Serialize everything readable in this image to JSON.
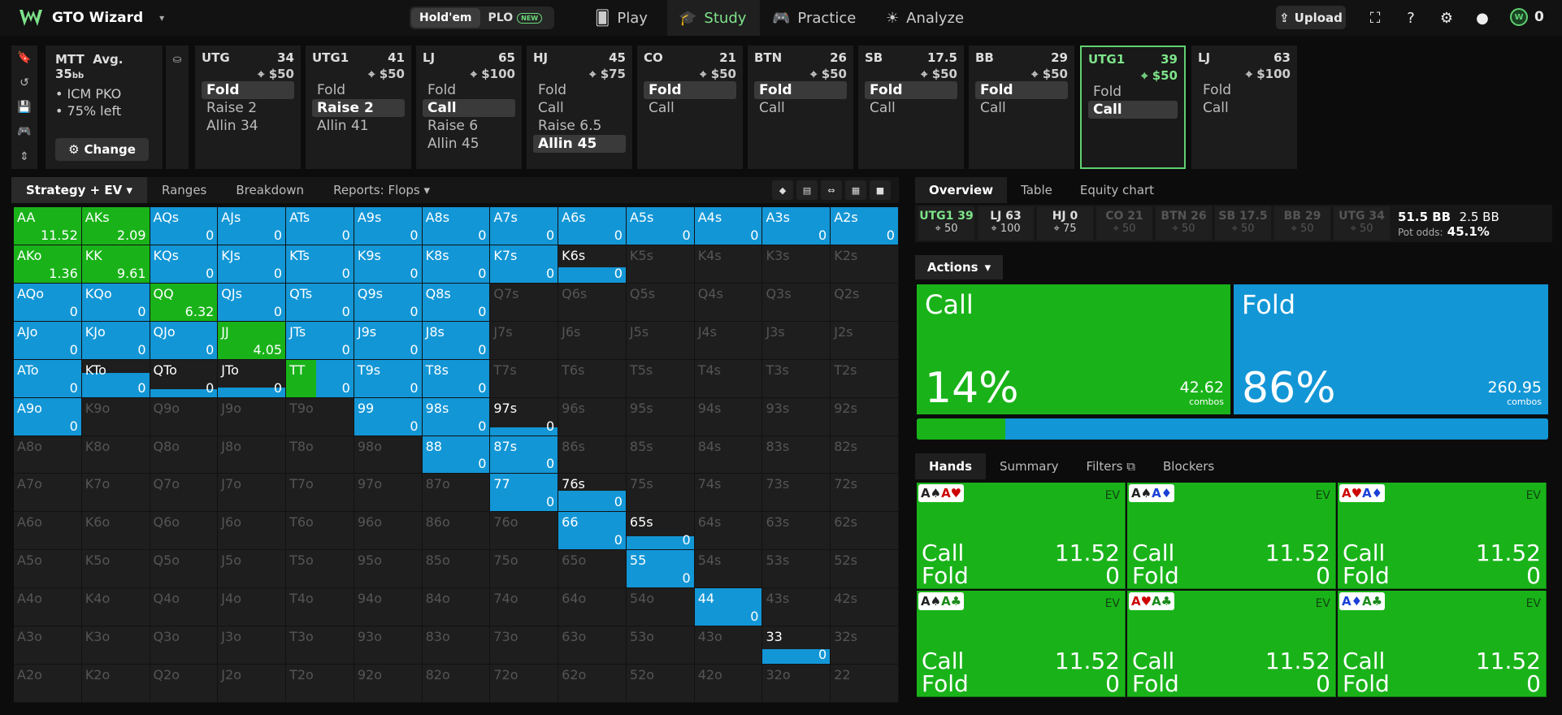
{
  "app": {
    "name": "GTO Wizard"
  },
  "gametype": {
    "holdem": "Hold'em",
    "plo": "PLO",
    "new_badge": "NEW"
  },
  "nav": [
    {
      "label": "Play",
      "icon": "cards-icon"
    },
    {
      "label": "Study",
      "icon": "graduation-cap-icon"
    },
    {
      "label": "Practice",
      "icon": "gamepad-icon"
    },
    {
      "label": "Analyze",
      "icon": "bulb-icon"
    }
  ],
  "topright": {
    "upload": "Upload",
    "coins": "0"
  },
  "mtt": {
    "title": "MTT",
    "avg": "Avg. 35",
    "bb_unit": "bb",
    "lines": [
      "ICM PKO",
      "75% left"
    ],
    "change": "Change"
  },
  "positions": [
    {
      "name": "UTG",
      "stack": "34",
      "bounty": "$50",
      "actions": [
        "Fold",
        "Raise 2",
        "Allin 34"
      ],
      "selected": 0
    },
    {
      "name": "UTG1",
      "stack": "41",
      "bounty": "$50",
      "actions": [
        "Fold",
        "Raise 2",
        "Allin 41"
      ],
      "selected": 1
    },
    {
      "name": "LJ",
      "stack": "65",
      "bounty": "$100",
      "actions": [
        "Fold",
        "Call",
        "Raise 6",
        "Allin 45"
      ],
      "selected": 1
    },
    {
      "name": "HJ",
      "stack": "45",
      "bounty": "$75",
      "actions": [
        "Fold",
        "Call",
        "Raise 6.5",
        "Allin 45"
      ],
      "selected": 3
    },
    {
      "name": "CO",
      "stack": "21",
      "bounty": "$50",
      "actions": [
        "Fold",
        "Call"
      ],
      "selected": 0
    },
    {
      "name": "BTN",
      "stack": "26",
      "bounty": "$50",
      "actions": [
        "Fold",
        "Call"
      ],
      "selected": 0
    },
    {
      "name": "SB",
      "stack": "17.5",
      "bounty": "$50",
      "actions": [
        "Fold",
        "Call"
      ],
      "selected": 0
    },
    {
      "name": "BB",
      "stack": "29",
      "bounty": "$50",
      "actions": [
        "Fold",
        "Call"
      ],
      "selected": 0
    },
    {
      "name": "UTG1",
      "stack": "39",
      "bounty": "$50",
      "actions": [
        "Fold",
        "Call"
      ],
      "selected": 1,
      "active": true
    },
    {
      "name": "LJ",
      "stack": "63",
      "bounty": "$100",
      "actions": [
        "Fold",
        "Call"
      ],
      "selected": -1
    }
  ],
  "strategy_tabs": [
    "Strategy + EV",
    "Ranges",
    "Breakdown",
    "Reports: Flops"
  ],
  "right_tabs": [
    "Overview",
    "Table",
    "Equity chart"
  ],
  "pos_strip": [
    {
      "name": "UTG1 39",
      "sub": "50",
      "style": "green"
    },
    {
      "name": "LJ 63",
      "sub": "100",
      "style": "normal"
    },
    {
      "name": "HJ 0",
      "sub": "75",
      "style": "normal"
    },
    {
      "name": "CO 21",
      "sub": "50",
      "style": "dim"
    },
    {
      "name": "BTN 26",
      "sub": "50",
      "style": "dim"
    },
    {
      "name": "SB 17.5",
      "sub": "50",
      "style": "dim"
    },
    {
      "name": "BB 29",
      "sub": "50",
      "style": "dim"
    },
    {
      "name": "UTG 34",
      "sub": "50",
      "style": "dim"
    }
  ],
  "pot": {
    "main": "51.5 BB",
    "side": "2.5 BB",
    "odds_label": "Pot odds:",
    "odds": "45.1%"
  },
  "actions_label": "Actions",
  "summary": [
    {
      "action": "Call",
      "pct": "14%",
      "combos": "42.62",
      "combos_label": "combos",
      "color": "#19b319",
      "freq": 0.14
    },
    {
      "action": "Fold",
      "pct": "86%",
      "combos": "260.95",
      "combos_label": "combos",
      "color": "#1296d6",
      "freq": 0.86
    }
  ],
  "hand_tabs": [
    "Hands",
    "Summary",
    "Filters",
    "Blockers"
  ],
  "hands": [
    {
      "c1": "A♠",
      "c2": "A♥",
      "s1": "#222",
      "s2": "#c00",
      "ev_label": "EV",
      "call": "11.52",
      "fold": "0"
    },
    {
      "c1": "A♠",
      "c2": "A♦",
      "s1": "#222",
      "s2": "#1a3fd6",
      "ev_label": "EV",
      "call": "11.52",
      "fold": "0"
    },
    {
      "c1": "A♥",
      "c2": "A♦",
      "s1": "#c00",
      "s2": "#1a3fd6",
      "ev_label": "EV",
      "call": "11.52",
      "fold": "0"
    },
    {
      "c1": "A♠",
      "c2": "A♣",
      "s1": "#222",
      "s2": "#1a8a1a",
      "ev_label": "EV",
      "call": "11.52",
      "fold": "0"
    },
    {
      "c1": "A♥",
      "c2": "A♣",
      "s1": "#c00",
      "s2": "#1a8a1a",
      "ev_label": "EV",
      "call": "11.52",
      "fold": "0"
    },
    {
      "c1": "A♦",
      "c2": "A♣",
      "s1": "#1a3fd6",
      "s2": "#1a8a1a",
      "ev_label": "EV",
      "call": "11.52",
      "fold": "0"
    }
  ],
  "hand_row_labels": {
    "call": "Call",
    "fold": "Fold"
  },
  "colors": {
    "call": "#19b319",
    "fold": "#1296d6",
    "accent": "#5fd070"
  },
  "matrix": {
    "ranks": [
      "A",
      "K",
      "Q",
      "J",
      "T",
      "9",
      "8",
      "7",
      "6",
      "5",
      "4",
      "3",
      "2"
    ],
    "comment": "call = green fraction (0..1), fold = blue fraction (0..1); missing = not in range; ev shown when present",
    "cells": {
      "AA": {
        "call": 1,
        "ev": "11.52"
      },
      "AKs": {
        "call": 1,
        "ev": "2.09"
      },
      "AQs": {
        "fold": 1,
        "ev": "0"
      },
      "AJs": {
        "fold": 1,
        "ev": "0"
      },
      "ATs": {
        "fold": 1,
        "ev": "0"
      },
      "A9s": {
        "fold": 1,
        "ev": "0"
      },
      "A8s": {
        "fold": 1,
        "ev": "0"
      },
      "A7s": {
        "fold": 1,
        "ev": "0"
      },
      "A6s": {
        "fold": 1,
        "ev": "0"
      },
      "A5s": {
        "fold": 1,
        "ev": "0"
      },
      "A4s": {
        "fold": 1,
        "ev": "0"
      },
      "A3s": {
        "fold": 1,
        "ev": "0"
      },
      "A2s": {
        "fold": 1,
        "ev": "0"
      },
      "AKo": {
        "call": 1,
        "ev": "1.36"
      },
      "KK": {
        "call": 1,
        "ev": "9.61"
      },
      "KQs": {
        "fold": 1,
        "ev": "0"
      },
      "KJs": {
        "fold": 1,
        "ev": "0"
      },
      "KTs": {
        "fold": 1,
        "ev": "0"
      },
      "K9s": {
        "fold": 1,
        "ev": "0"
      },
      "K8s": {
        "fold": 1,
        "ev": "0"
      },
      "K7s": {
        "fold": 1,
        "ev": "0"
      },
      "K6s": {
        "fold": 0.4,
        "ev": "0"
      },
      "AQo": {
        "fold": 1,
        "ev": "0"
      },
      "KQo": {
        "fold": 1,
        "ev": "0"
      },
      "QQ": {
        "call": 1,
        "ev": "6.32"
      },
      "QJs": {
        "fold": 1,
        "ev": "0"
      },
      "QTs": {
        "fold": 1,
        "ev": "0"
      },
      "Q9s": {
        "fold": 1,
        "ev": "0"
      },
      "Q8s": {
        "fold": 1,
        "ev": "0"
      },
      "AJo": {
        "fold": 1,
        "ev": "0"
      },
      "KJo": {
        "fold": 1,
        "ev": "0"
      },
      "QJo": {
        "fold": 1,
        "ev": "0"
      },
      "JJ": {
        "call": 1,
        "ev": "4.05"
      },
      "JTs": {
        "fold": 1,
        "ev": "0"
      },
      "J9s": {
        "fold": 1,
        "ev": "0"
      },
      "J8s": {
        "fold": 1,
        "ev": "0"
      },
      "ATo": {
        "fold": 1,
        "ev": "0"
      },
      "KTo": {
        "fold": 0.65,
        "ev": "0"
      },
      "QTo": {
        "fold": 0.2,
        "ev": "0"
      },
      "JTo": {
        "fold": 0.25,
        "ev": "0"
      },
      "TT": {
        "call": 0.45,
        "fold": 0.55,
        "ev": "0"
      },
      "T9s": {
        "fold": 1,
        "ev": "0"
      },
      "T8s": {
        "fold": 1,
        "ev": "0"
      },
      "A9o": {
        "fold": 1,
        "ev": "0"
      },
      "99": {
        "fold": 1,
        "ev": "0"
      },
      "98s": {
        "fold": 1,
        "ev": "0"
      },
      "97s": {
        "fold": 0.2,
        "ev": "0"
      },
      "88": {
        "fold": 1,
        "ev": "0"
      },
      "87s": {
        "fold": 1,
        "ev": "0"
      },
      "77": {
        "fold": 1,
        "ev": "0"
      },
      "76s": {
        "fold": 0.55,
        "ev": "0"
      },
      "66": {
        "fold": 1,
        "ev": "0"
      },
      "65s": {
        "fold": 0.35,
        "ev": "0"
      },
      "55": {
        "fold": 1,
        "ev": "0"
      },
      "44": {
        "fold": 1,
        "ev": "0"
      },
      "33": {
        "fold": 0.4,
        "ev": "0"
      },
      "22": {}
    }
  }
}
